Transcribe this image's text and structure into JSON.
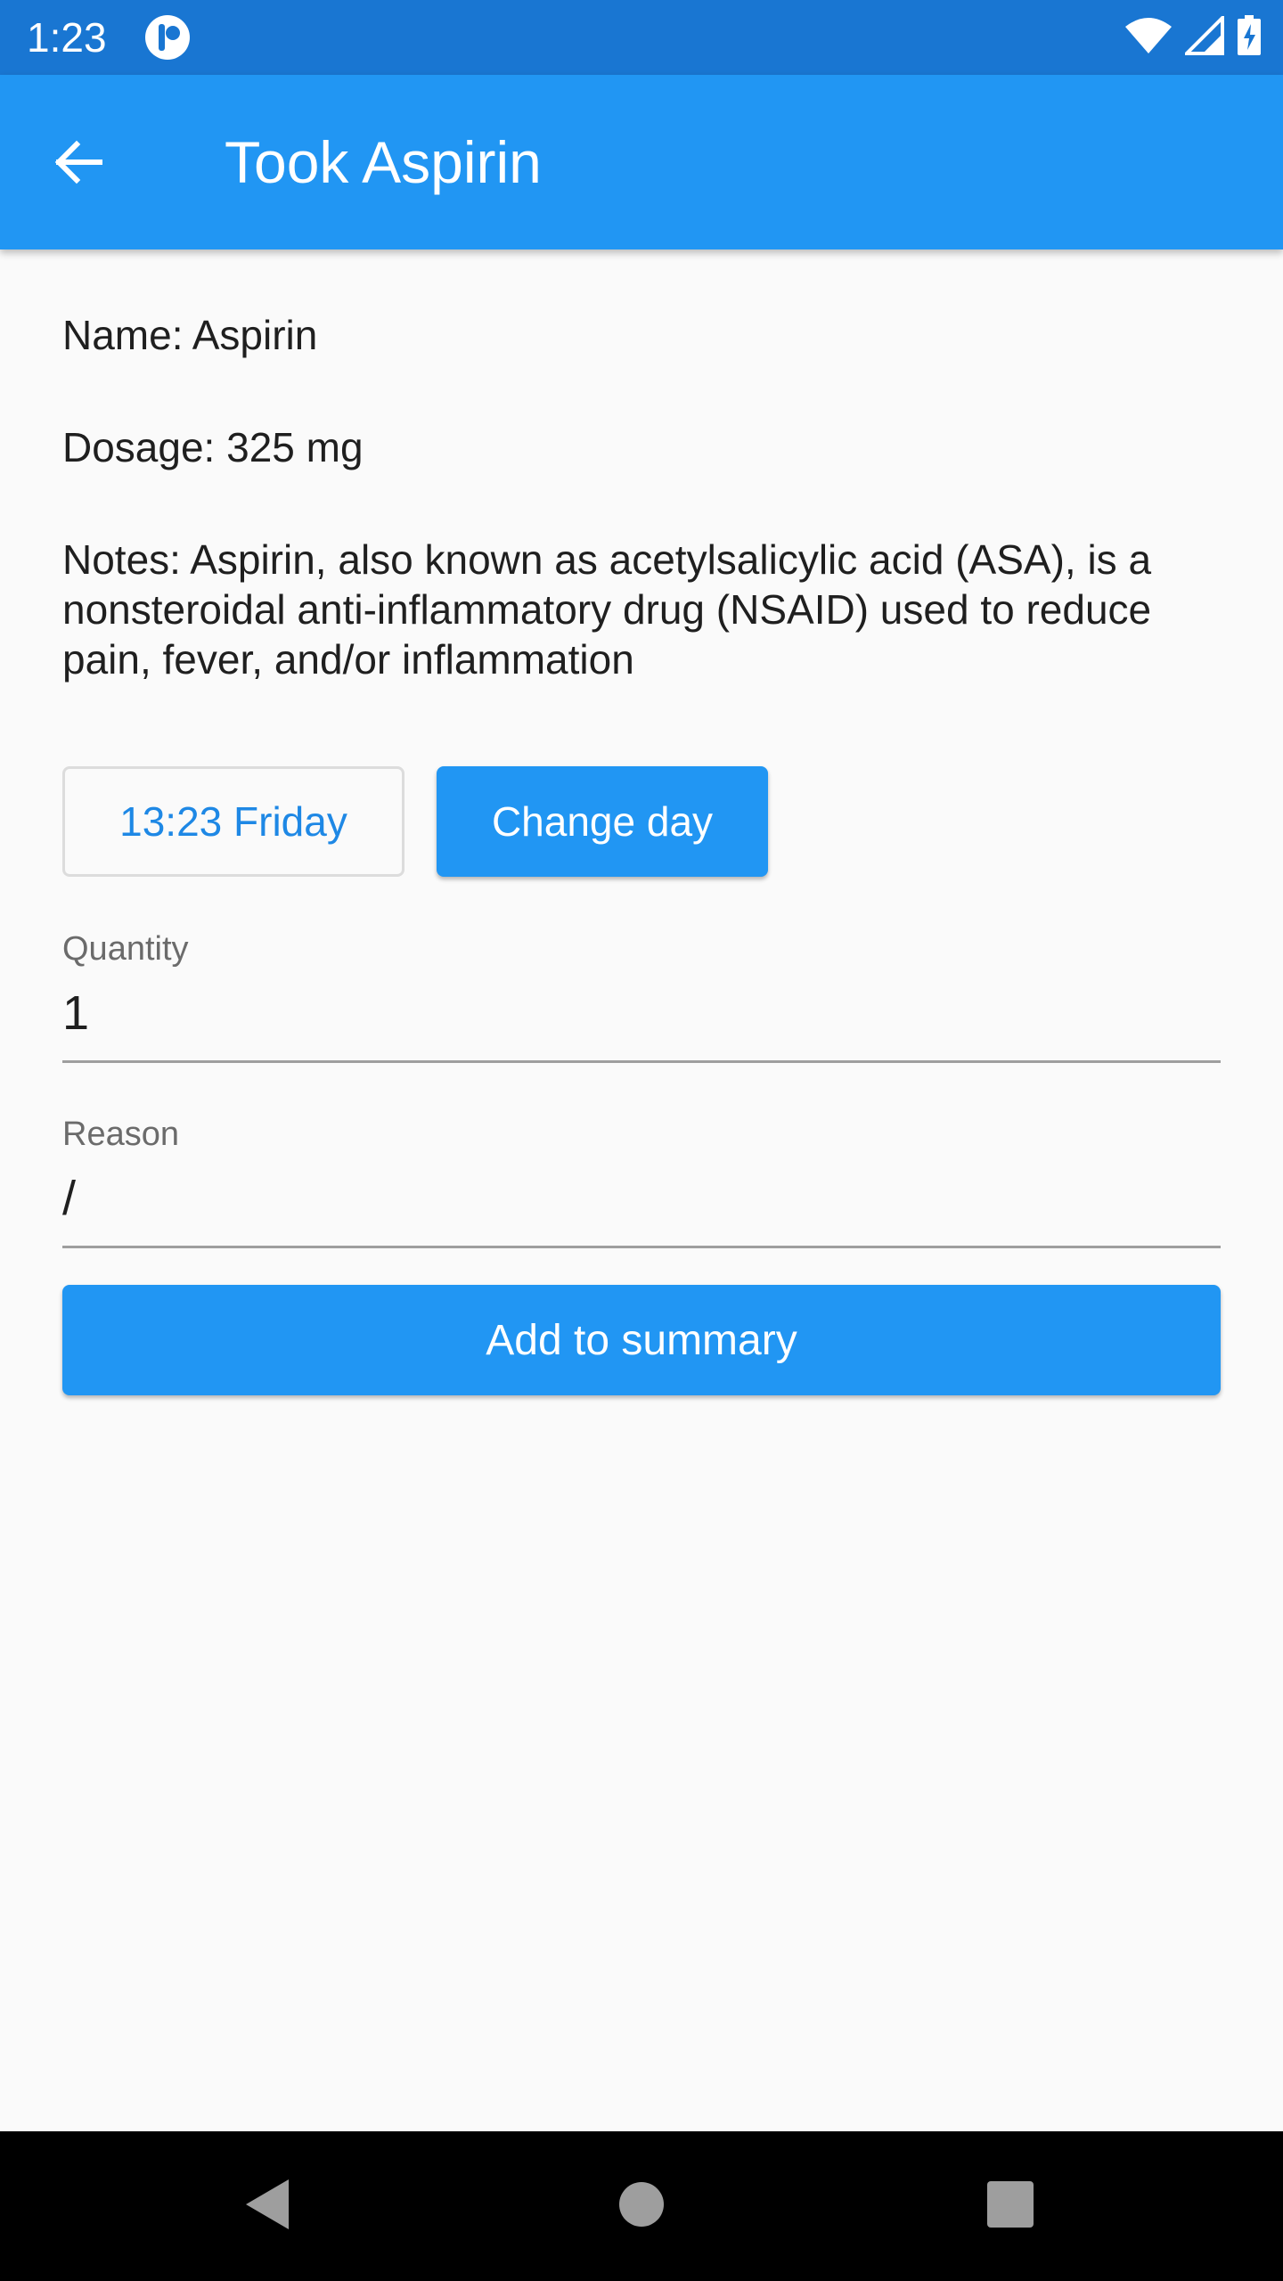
{
  "status_bar": {
    "time": "1:23",
    "icons": [
      "app-notification-icon",
      "wifi-icon",
      "cell-signal-icon",
      "battery-charging-icon"
    ]
  },
  "app_bar": {
    "title": "Took Aspirin",
    "back_icon": "arrow-back-icon"
  },
  "details": {
    "name": "Name: Aspirin",
    "dosage": "Dosage: 325 mg",
    "notes": "Notes: Aspirin, also known as acetylsalicylic acid (ASA), is a nonsteroidal anti-inflammatory drug (NSAID) used to reduce pain, fever, and/or inflammation"
  },
  "actions": {
    "time_label": "13:23 Friday",
    "change_day_label": "Change day",
    "add_label": "Add to summary"
  },
  "form": {
    "quantity": {
      "label": "Quantity",
      "value": "1"
    },
    "reason": {
      "label": "Reason",
      "value": "/"
    }
  },
  "nav_bar": {
    "icons": [
      "nav-back-icon",
      "nav-home-icon",
      "nav-recents-icon"
    ]
  },
  "colors": {
    "status_bar": "#1976d2",
    "primary": "#2196f3",
    "accent_text": "#1e88e5",
    "background": "#fafafa"
  }
}
